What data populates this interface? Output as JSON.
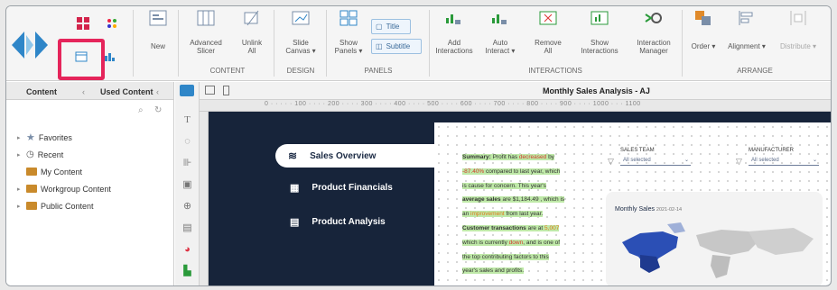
{
  "ribbon": {
    "buttons": [
      {
        "label": "New"
      },
      {
        "label": "Advanced\nSlicer"
      },
      {
        "label": "Unlink\nAll"
      },
      {
        "label": "Slide\nCanvas ▾"
      },
      {
        "label": "Show\nPanels ▾"
      },
      {
        "label": "Add\nInteractions"
      },
      {
        "label": "Auto\nInteract ▾"
      },
      {
        "label": "Remove\nAll"
      },
      {
        "label": "Show\nInteractions"
      },
      {
        "label": "Interaction\nManager"
      },
      {
        "label": "Order ▾"
      },
      {
        "label": "Alignment ▾"
      },
      {
        "label": "Distribute ▾"
      }
    ],
    "title_pill": "Title",
    "subtitle_pill": "Subtitle",
    "groups": {
      "content": "CONTENT",
      "design": "DESIGN",
      "panels": "PANELS",
      "interactions": "INTERACTIONS",
      "arrange": "ARRANGE"
    }
  },
  "left_panel": {
    "tab_content": "Content",
    "tab_used": "Used Content",
    "tree": [
      {
        "label": "Favorites",
        "icon": "star-icon"
      },
      {
        "label": "Recent",
        "icon": "clock-icon"
      },
      {
        "label": "My Content",
        "icon": "folder-icon"
      },
      {
        "label": "Workgroup Content",
        "icon": "folder-icon"
      },
      {
        "label": "Public Content",
        "icon": "folder-icon"
      }
    ]
  },
  "canvas": {
    "title": "Monthly Sales Analysis - AJ",
    "ruler_labels": [
      "0",
      "100",
      "200",
      "300",
      "400",
      "500",
      "600",
      "700",
      "800",
      "900",
      "1000",
      "1100"
    ]
  },
  "dashboard": {
    "nav": [
      "Sales Overview",
      "Product Financials",
      "Product Analysis"
    ],
    "summary": {
      "t1": "Summary:",
      "t2": "Profit",
      "t3": "has",
      "t4": "decreased",
      "t5": "by",
      "t6": "-87.40%",
      "t7": "compared to last year, which",
      "t8": "is cause for concern.",
      "t9": "This year's",
      "t10": "average sales",
      "t11": "are",
      "t12": "$1,184.49",
      "t13": ", which is",
      "t14": "an",
      "t15": "improvement",
      "t16": "from last year.",
      "t17": "Customer transactions",
      "t18": "are at",
      "t19": "5,007",
      "t20": "which is currently",
      "t21": "down",
      "t22": ", and is one of",
      "t23": "the top contributing factors to this",
      "t24": "year's sales and profits."
    },
    "filters": [
      {
        "label": "SALES TEAM",
        "value": "All selected"
      },
      {
        "label": "MANUFACTURER",
        "value": "All selected"
      }
    ],
    "map": {
      "title": "Monthly Sales",
      "date": "2021-02-14"
    }
  },
  "colors": {
    "accent": "#e5255b",
    "dash_bg": "#17243a",
    "highlight": "#bfe9a8"
  }
}
